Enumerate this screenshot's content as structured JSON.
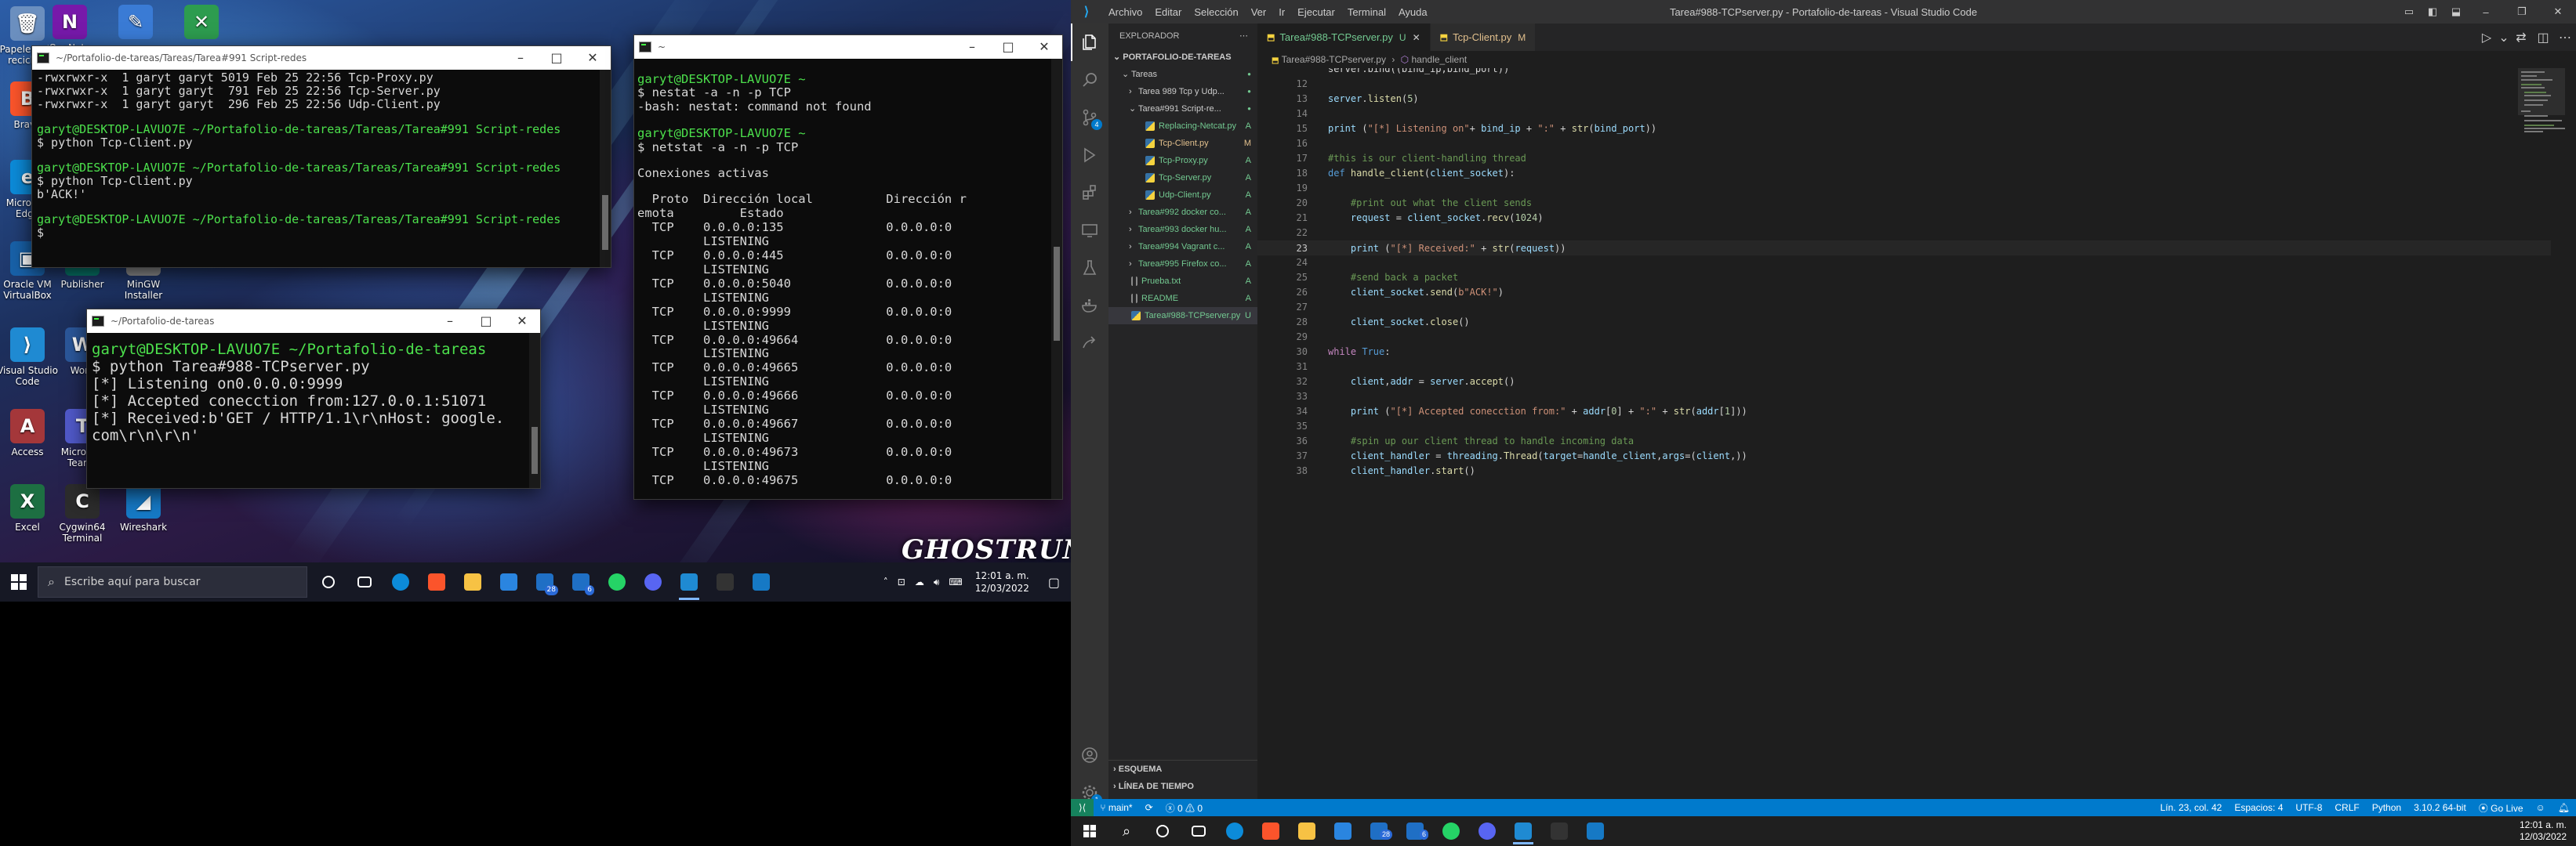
{
  "left_desktop": {
    "icons": [
      {
        "label": "Papelera de reciclaje",
        "glyph": "🗑",
        "color": "#6b8fbf"
      },
      {
        "label": "OneNote",
        "glyph": "N",
        "color": "#7719aa"
      },
      {
        "label": "",
        "glyph": "✎",
        "color": "#3a7bd5"
      },
      {
        "label": "",
        "glyph": "✕",
        "color": "#2d9c4f"
      },
      {
        "label": "Brave",
        "glyph": "B",
        "color": "#fb542b"
      },
      {
        "label": "Microsoft Edge",
        "glyph": "e",
        "color": "#0c8bd9"
      },
      {
        "label": "Oracle VM VirtualBox",
        "glyph": "▣",
        "color": "#1861a8"
      },
      {
        "label": "Publisher",
        "glyph": "P",
        "color": "#077568"
      },
      {
        "label": "MinGW Installer",
        "glyph": "G",
        "color": "#8a8a8a"
      },
      {
        "label": "Visual Studio Code",
        "glyph": "⟩",
        "color": "#1f8ad2"
      },
      {
        "label": "Word",
        "glyph": "W",
        "color": "#2b579a"
      },
      {
        "label": "Access",
        "glyph": "A",
        "color": "#a4373a"
      },
      {
        "label": "Microsoft Teams",
        "glyph": "T",
        "color": "#5059c9"
      },
      {
        "label": "Excel",
        "glyph": "X",
        "color": "#1d6f42"
      },
      {
        "label": "Cygwin64 Terminal",
        "glyph": "C",
        "color": "#2c2c2c"
      },
      {
        "label": "Wireshark",
        "glyph": "◢",
        "color": "#1679c5"
      }
    ],
    "wallpaper_logo": "GHOSTRUNNER",
    "terminal1": {
      "title": "~/Portafolio-de-tareas/Tareas/Tarea#991 Script-redes",
      "lines": [
        {
          "t": "-rwxrwxr-x  1 garyt garyt 5019 Feb 25 22:56 Tcp-Proxy.py",
          "c": "w"
        },
        {
          "t": "-rwxrwxr-x  1 garyt garyt  791 Feb 25 22:56 Tcp-Server.py",
          "c": "w"
        },
        {
          "t": "-rwxrwxr-x  1 garyt garyt  296 Feb 25 22:56 Udp-Client.py",
          "c": "w"
        },
        {
          "t": "",
          "c": "w"
        },
        {
          "t": "garyt@DESKTOP-LAVUO7E ~/Portafolio-de-tareas/Tareas/Tarea#991 Script-redes",
          "c": "p"
        },
        {
          "t": "$ python Tcp-Client.py",
          "c": "w"
        },
        {
          "t": "",
          "c": "w"
        },
        {
          "t": "garyt@DESKTOP-LAVUO7E ~/Portafolio-de-tareas/Tareas/Tarea#991 Script-redes",
          "c": "p"
        },
        {
          "t": "$ python Tcp-Client.py",
          "c": "w"
        },
        {
          "t": "b'ACK!'",
          "c": "w"
        },
        {
          "t": "",
          "c": "w"
        },
        {
          "t": "garyt@DESKTOP-LAVUO7E ~/Portafolio-de-tareas/Tareas/Tarea#991 Script-redes",
          "c": "p"
        },
        {
          "t": "$",
          "c": "w"
        }
      ]
    },
    "terminal2": {
      "title": "~/Portafolio-de-tareas",
      "lines": [
        {
          "t": "garyt@DESKTOP-LAVUO7E ~/Portafolio-de-tareas",
          "c": "p"
        },
        {
          "t": "$ python Tarea#988-TCPserver.py",
          "c": "w"
        },
        {
          "t": "[*] Listening on0.0.0.0:9999",
          "c": "w"
        },
        {
          "t": "[*] Accepted conecction from:127.0.0.1:51071",
          "c": "w"
        },
        {
          "t": "[*] Received:b'GET / HTTP/1.1\\r\\nHost: google.",
          "c": "w"
        },
        {
          "t": "com\\r\\n\\r\\n'",
          "c": "w"
        }
      ]
    },
    "terminal3": {
      "title": "~",
      "lines": [
        {
          "t": "",
          "c": "w"
        },
        {
          "t": "garyt@DESKTOP-LAVUO7E ~",
          "c": "p"
        },
        {
          "t": "$ nestat -a -n -p TCP",
          "c": "w"
        },
        {
          "t": "-bash: nestat: command not found",
          "c": "w"
        },
        {
          "t": "",
          "c": "w"
        },
        {
          "t": "garyt@DESKTOP-LAVUO7E ~",
          "c": "p"
        },
        {
          "t": "$ netstat -a -n -p TCP",
          "c": "w"
        },
        {
          "t": "",
          "c": "w"
        },
        {
          "t": "Conexiones activas",
          "c": "w"
        },
        {
          "t": "",
          "c": "w"
        },
        {
          "t": "  Proto  Dirección local          Dirección r",
          "c": "w"
        },
        {
          "t": "emota         Estado",
          "c": "w"
        },
        {
          "t": "  TCP    0.0.0.0:135              0.0.0.0:0",
          "c": "w"
        },
        {
          "t": "         LISTENING",
          "c": "w"
        },
        {
          "t": "  TCP    0.0.0.0:445              0.0.0.0:0",
          "c": "w"
        },
        {
          "t": "         LISTENING",
          "c": "w"
        },
        {
          "t": "  TCP    0.0.0.0:5040             0.0.0.0:0",
          "c": "w"
        },
        {
          "t": "         LISTENING",
          "c": "w"
        },
        {
          "t": "  TCP    0.0.0.0:9999             0.0.0.0:0",
          "c": "w"
        },
        {
          "t": "         LISTENING",
          "c": "w"
        },
        {
          "t": "  TCP    0.0.0.0:49664            0.0.0.0:0",
          "c": "w"
        },
        {
          "t": "         LISTENING",
          "c": "w"
        },
        {
          "t": "  TCP    0.0.0.0:49665            0.0.0.0:0",
          "c": "w"
        },
        {
          "t": "         LISTENING",
          "c": "w"
        },
        {
          "t": "  TCP    0.0.0.0:49666            0.0.0.0:0",
          "c": "w"
        },
        {
          "t": "         LISTENING",
          "c": "w"
        },
        {
          "t": "  TCP    0.0.0.0:49667            0.0.0.0:0",
          "c": "w"
        },
        {
          "t": "         LISTENING",
          "c": "w"
        },
        {
          "t": "  TCP    0.0.0.0:49673            0.0.0.0:0",
          "c": "w"
        },
        {
          "t": "         LISTENING",
          "c": "w"
        },
        {
          "t": "  TCP    0.0.0.0:49675            0.0.0.0:0",
          "c": "w"
        }
      ]
    },
    "taskbar": {
      "search_placeholder": "Escribe aquí para buscar",
      "time": "12:01 a. m.",
      "date": "12/03/2022",
      "apps": [
        {
          "name": "cortana-icon",
          "color": "#ffffff"
        },
        {
          "name": "task-view-icon",
          "color": "#ffffff"
        },
        {
          "name": "edge-icon",
          "color": "#0c8bd9"
        },
        {
          "name": "brave-icon",
          "color": "#fb542b"
        },
        {
          "name": "explorer-icon",
          "color": "#f7c244"
        },
        {
          "name": "store-icon",
          "color": "#2a85e0"
        },
        {
          "name": "mail-icon",
          "color": "#1f6fc5"
        },
        {
          "name": "calendar-icon",
          "color": "#1f6fc5"
        },
        {
          "name": "whatsapp-icon",
          "color": "#25d366"
        },
        {
          "name": "discord-icon",
          "color": "#5865f2"
        },
        {
          "name": "vscode-icon",
          "color": "#1f8ad2"
        },
        {
          "name": "terminal-icon",
          "color": "#333333"
        },
        {
          "name": "wireshark-icon",
          "color": "#1679c5"
        }
      ],
      "mail_badge": "28",
      "calendar_badge": "6"
    }
  },
  "vscode": {
    "menu": [
      "Archivo",
      "Editar",
      "Selección",
      "Ver",
      "Ir",
      "Ejecutar",
      "Terminal",
      "Ayuda"
    ],
    "window_title": "Tarea#988-TCPserver.py - Portafolio-de-tareas - Visual Studio Code",
    "explorer_header": "EXPLORADOR",
    "workspace": "PORTAFOLIO-DE-TAREAS",
    "tree": [
      {
        "label": "Tareas",
        "indent": 1,
        "kind": "folder-open",
        "status": "",
        "status_color": "#73c991"
      },
      {
        "label": "Tarea 989 Tcp y Udp...",
        "indent": 2,
        "kind": "folder",
        "status": "",
        "status_color": "#73c991"
      },
      {
        "label": "Tarea#991 Script-re...",
        "indent": 2,
        "kind": "folder-open",
        "status": "",
        "status_color": "#73c991"
      },
      {
        "label": "Replacing-Netcat.py",
        "indent": 3,
        "kind": "py",
        "status": "A",
        "status_color": "#73c991"
      },
      {
        "label": "Tcp-Client.py",
        "indent": 3,
        "kind": "py",
        "status": "M",
        "status_color": "#e2c08d"
      },
      {
        "label": "Tcp-Proxy.py",
        "indent": 3,
        "kind": "py",
        "status": "A",
        "status_color": "#73c991"
      },
      {
        "label": "Tcp-Server.py",
        "indent": 3,
        "kind": "py",
        "status": "A",
        "status_color": "#73c991"
      },
      {
        "label": "Udp-Client.py",
        "indent": 3,
        "kind": "py",
        "status": "A",
        "status_color": "#73c991"
      },
      {
        "label": "Tarea#992 docker co...",
        "indent": 2,
        "kind": "folder",
        "status": "A",
        "status_color": "#73c991"
      },
      {
        "label": "Tarea#993 docker hu...",
        "indent": 2,
        "kind": "folder",
        "status": "A",
        "status_color": "#73c991"
      },
      {
        "label": "Tarea#994 Vagrant c...",
        "indent": 2,
        "kind": "folder",
        "status": "A",
        "status_color": "#73c991"
      },
      {
        "label": "Tarea#995 Firefox co...",
        "indent": 2,
        "kind": "folder",
        "status": "A",
        "status_color": "#73c991"
      },
      {
        "label": "Prueba.txt",
        "indent": 1,
        "kind": "txt",
        "status": "A",
        "status_color": "#73c991"
      },
      {
        "label": "README",
        "indent": 1,
        "kind": "txt",
        "status": "A",
        "status_color": "#73c991"
      },
      {
        "label": "Tarea#988-TCPserver.py",
        "indent": 1,
        "kind": "py",
        "status": "U",
        "status_color": "#73c991",
        "selected": true
      }
    ],
    "outline_label": "ESQUEMA",
    "timeline_label": "LÍNEA DE TIEMPO",
    "tabs": [
      {
        "label": "Tarea#988-TCPserver.py",
        "mark": "U",
        "active": true
      },
      {
        "label": "Tcp-Client.py",
        "mark": "M",
        "active": false
      }
    ],
    "breadcrumb": [
      "Tarea#988-TCPserver.py",
      "handle_client"
    ],
    "first_line_fragment": "server.bind((bind_ip,bind_port))",
    "code": [
      {
        "n": "12",
        "html": ""
      },
      {
        "n": "13",
        "html": "server.listen(5)"
      },
      {
        "n": "14",
        "html": ""
      },
      {
        "n": "15",
        "html": "print (\"[*] Listening on\"+ bind_ip + \":\" + str(bind_port))"
      },
      {
        "n": "16",
        "html": ""
      },
      {
        "n": "17",
        "html": "#this is our client-handling thread"
      },
      {
        "n": "18",
        "html": "def handle_client(client_socket):"
      },
      {
        "n": "19",
        "html": ""
      },
      {
        "n": "20",
        "html": "    #print out what the client sends"
      },
      {
        "n": "21",
        "html": "    request = client_socket.recv(1024)"
      },
      {
        "n": "22",
        "html": ""
      },
      {
        "n": "23",
        "html": "    print (\"[*] Received:\" + str(request))"
      },
      {
        "n": "24",
        "html": ""
      },
      {
        "n": "25",
        "html": "    #send back a packet"
      },
      {
        "n": "26",
        "html": "    client_socket.send(b\"ACK!\")"
      },
      {
        "n": "27",
        "html": ""
      },
      {
        "n": "28",
        "html": "    client_socket.close()"
      },
      {
        "n": "29",
        "html": ""
      },
      {
        "n": "30",
        "html": "while True:"
      },
      {
        "n": "31",
        "html": ""
      },
      {
        "n": "32",
        "html": "    client,addr = server.accept()"
      },
      {
        "n": "33",
        "html": ""
      },
      {
        "n": "34",
        "html": "    print (\"[*] Accepted conecction from:\" + addr[0] + \":\" + str(addr[1]))"
      },
      {
        "n": "35",
        "html": ""
      },
      {
        "n": "36",
        "html": "    #spin up our client thread to handle incoming data"
      },
      {
        "n": "37",
        "html": "    client_handler = threading.Thread(target=handle_client,args=(client,))"
      },
      {
        "n": "38",
        "html": "    client_handler.start()"
      }
    ],
    "current_line": "23",
    "status": {
      "branch": "main*",
      "problems": "0",
      "warnings": "0",
      "position": "Lín. 23, col. 42",
      "spaces": "Espacios: 4",
      "encoding": "UTF-8",
      "eol": "CRLF",
      "language": "Python",
      "interpreter": "3.10.2 64-bit",
      "golive": "Go Live"
    },
    "taskbar": {
      "time": "12:01 a. m.",
      "date": "12/03/2022",
      "mail_badge": "28",
      "calendar_badge": "6"
    },
    "colors": {
      "accent": "#007acc",
      "sidebar": "#252526",
      "editor": "#1e1e1e"
    }
  }
}
